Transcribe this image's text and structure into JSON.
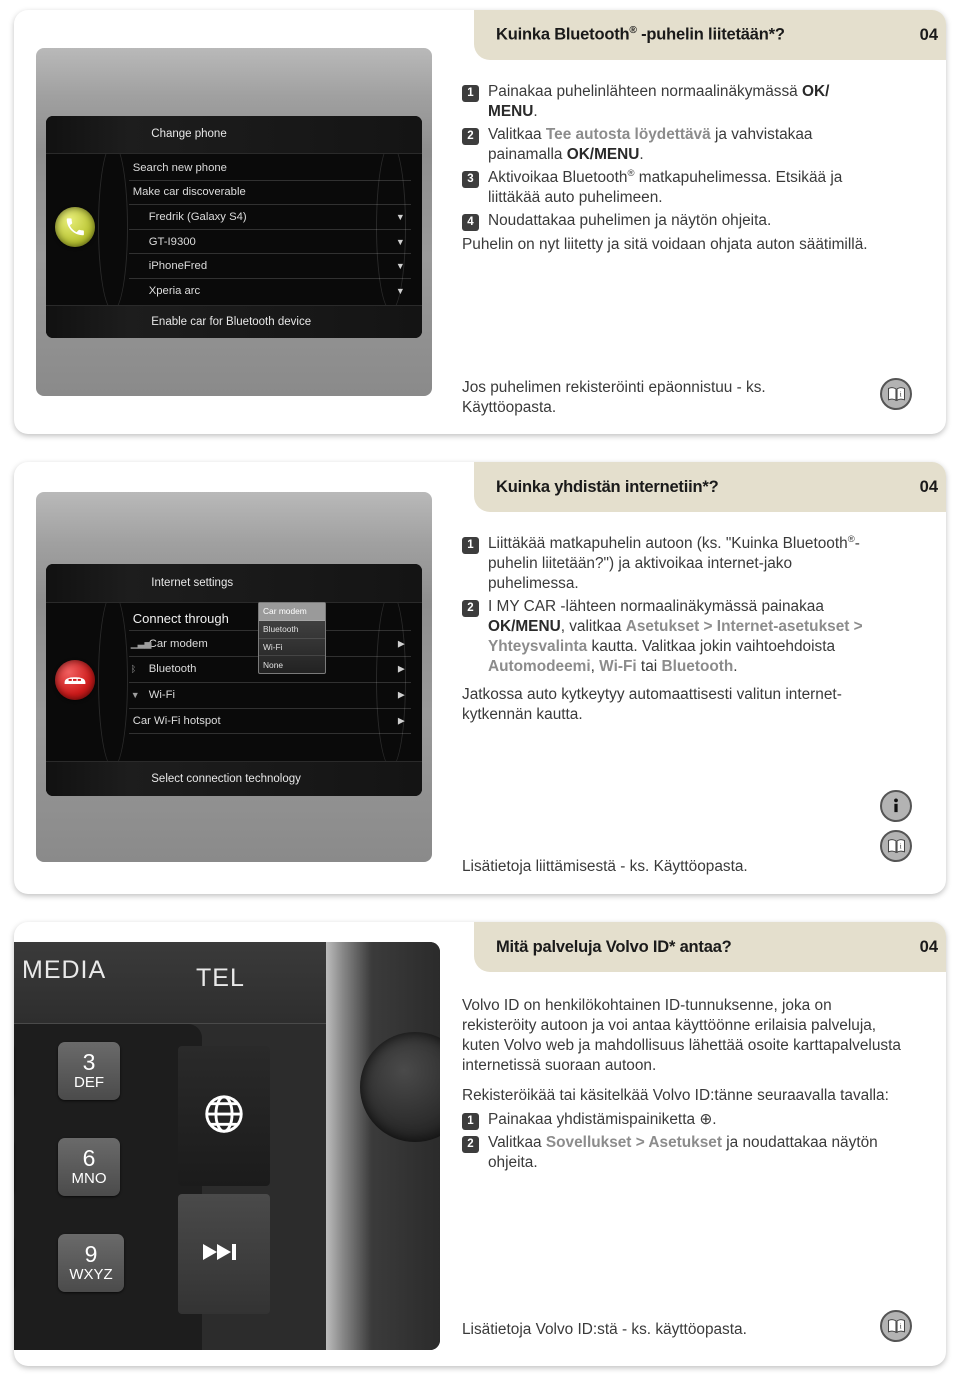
{
  "page": {
    "chapter_number": "04"
  },
  "sections": [
    {
      "id": "bluetooth-phone",
      "header": {
        "title_main": "Kuinka Bluetooth",
        "title_sup": "®",
        "title_rest": " -puhelin liitetään*?",
        "number": "04"
      },
      "steps": [
        {
          "num": "1",
          "html": "Painakaa puhelinlähteen normaalinäkymässä <b>OK/ MENU</b>."
        },
        {
          "num": "2",
          "html": "Valitkaa <span class=\"menu\">Tee autosta löydettävä</span> ja vahvistakaa painamalla <b>OK/MENU</b>."
        },
        {
          "num": "3",
          "html": "Aktivoikaa Bluetooth<span class=\"sup\">®</span> matkapuhelimessa. Etsikää ja liittäkää auto puhelimeen."
        },
        {
          "num": "4",
          "html": "Noudattakaa puhelimen ja näytön ohjeita."
        }
      ],
      "paragraphs": [
        "Puhelin on nyt liitetty ja sitä voidaan ohjata auton säätimillä."
      ],
      "footnote": "Jos puhelimen rekisteröinti epäonnistuu - ks. Käyttöopasta.",
      "icons": [
        "book-info-icon"
      ],
      "screen": {
        "title": "Change phone",
        "footer": "Enable car for Bluetooth device",
        "source_button": "phone-handset-icon",
        "rows": [
          {
            "label": "Search new phone",
            "arrow": false,
            "indent": false,
            "big": false
          },
          {
            "label": "Make car discoverable",
            "arrow": false,
            "indent": false,
            "big": false
          },
          {
            "label": "Fredrik (Galaxy S4)",
            "arrow": true,
            "indent": true,
            "big": false
          },
          {
            "label": "GT-I9300",
            "arrow": true,
            "indent": true,
            "big": false
          },
          {
            "label": "iPhoneFred",
            "arrow": true,
            "indent": true,
            "big": false
          },
          {
            "label": "Xperia arc",
            "arrow": true,
            "indent": true,
            "big": false
          }
        ]
      }
    },
    {
      "id": "internet-connect",
      "header": {
        "title_main": "Kuinka yhdistän internetiin*?",
        "title_sup": "",
        "title_rest": "",
        "number": "04"
      },
      "steps": [
        {
          "num": "1",
          "html": "Liittäkää matkapuhelin autoon (ks. \"Kuinka Bluetooth<span class=\"sup\">®</span>-puhelin liitetään?\") ja aktivoikaa internet-jako puhelimessa."
        },
        {
          "num": "2",
          "html": "I MY CAR -lähteen normaalinäkymässä painakaa <b>OK/MENU</b>, valitkaa <span class=\"menu\">Asetukset &gt; Internet-asetukset &gt; Yhteysvalinta</span> kautta. Valitkaa jokin vaihtoehdoista <span class=\"menu\">Automodeemi</span>, <span class=\"menu\">Wi-Fi</span> tai <span class=\"menu\">Bluetooth</span>."
        }
      ],
      "paragraphs": [
        "Jatkossa auto kytkeytyy automaattisesti valitun internet-kytkennän kautta."
      ],
      "footnote": "Lisätietoja liittämisestä - ks. Käyttöopasta.",
      "icons": [
        "info-circle-icon",
        "book-info-icon"
      ],
      "screen": {
        "title": "Internet settings",
        "footer": "Select connection technology",
        "source_button": "car-icon",
        "rows": [
          {
            "label": "Connect through",
            "arrow": false,
            "indent": false,
            "big": true
          },
          {
            "label": "Car modem",
            "arrow": true,
            "indent": true,
            "big": false,
            "icon": "signal-3g-icon"
          },
          {
            "label": "Bluetooth",
            "arrow": true,
            "indent": true,
            "big": false,
            "icon": "bluetooth-icon"
          },
          {
            "label": "Wi-Fi",
            "arrow": true,
            "indent": true,
            "big": false,
            "icon": "wifi-icon"
          },
          {
            "label": "Car Wi-Fi hotspot",
            "arrow": true,
            "indent": false,
            "big": false
          },
          {
            "label": "",
            "arrow": false,
            "indent": false,
            "big": false
          }
        ],
        "popup": {
          "options": [
            "Car modem",
            "Bluetooth",
            "Wi-Fi",
            "None"
          ],
          "selected": "Car modem"
        }
      }
    },
    {
      "id": "volvo-id",
      "header": {
        "title_main": "Mitä palveluja Volvo ID* antaa?",
        "title_sup": "",
        "title_rest": "",
        "number": "04"
      },
      "paragraphs": [
        "Volvo ID on henkilökohtainen ID-tunnuksenne, joka on rekisteröity autoon ja voi antaa käyttöönne erilaisia palveluja, kuten Volvo web ja mahdollisuus lähettää osoite karttapalvelusta internetissä suoraan autoon.",
        "Rekisteröikää tai käsitelkää Volvo ID:tänne seuraavalla tavalla:"
      ],
      "steps": [
        {
          "num": "1",
          "html": "Painakaa yhdistämispainiketta ⊕."
        },
        {
          "num": "2",
          "html": "Valitkaa <span class=\"menu\">Sovellukset &gt; Asetukset</span> ja noudattakaa näytön ohjeita."
        }
      ],
      "footnote": "Lisätietoja Volvo ID:stä - ks. käyttöopasta.",
      "icons": [
        "book-info-icon"
      ],
      "keypad": {
        "labels": {
          "media": "MEDIA",
          "tel": "TEL"
        },
        "keys": [
          {
            "num": "3",
            "letters": "DEF"
          },
          {
            "num": "6",
            "letters": "MNO"
          },
          {
            "num": "9",
            "letters": "WXYZ"
          }
        ],
        "side_buttons": [
          "globe-icon",
          "next-track-icon"
        ]
      }
    }
  ],
  "colors": {
    "header_beige": "#e4dfcd",
    "badge_dark": "#3d3d3d",
    "menu_gray": "#8c8c8c",
    "body_text": "#3a3a3a",
    "icon_gray": "#b3b3b3"
  }
}
